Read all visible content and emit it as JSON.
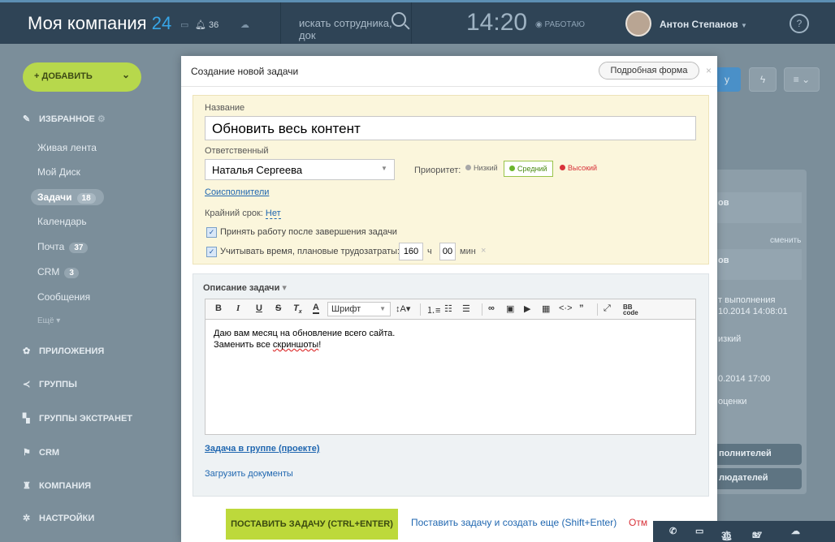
{
  "header": {
    "logo_text": "Моя компания",
    "logo_num": "24",
    "notif_count": "36",
    "search_placeholder": "искать сотрудника, док",
    "time": "14:20",
    "work_status": "РАБОТАЮ",
    "user_name": "Антон Степанов",
    "help": "?"
  },
  "sidebar": {
    "add_label": "ДОБАВИТЬ",
    "favorites": "ИЗБРАННОЕ",
    "items": [
      {
        "label": "Живая лента",
        "badge": ""
      },
      {
        "label": "Мой Диск",
        "badge": ""
      },
      {
        "label": "Задачи",
        "badge": "18"
      },
      {
        "label": "Календарь",
        "badge": ""
      },
      {
        "label": "Почта",
        "badge": "37"
      },
      {
        "label": "CRM",
        "badge": "3"
      },
      {
        "label": "Сообщения",
        "badge": ""
      }
    ],
    "more": "Ещё",
    "sections": [
      "ПРИЛОЖЕНИЯ",
      "ГРУППЫ",
      "ГРУППЫ ЭКСТРАНЕТ",
      "CRM",
      "КОМПАНИЯ",
      "НАСТРОЙКИ"
    ]
  },
  "background": {
    "frag_1": "ов",
    "change": "сменить",
    "frag_2": "ов",
    "exec_label": "т выполнения",
    "exec_date": "10.2014 14:08:01",
    "prio_frag": "изкий",
    "deadline_frag": "0.2014 17:00",
    "eval_frag": "оценки",
    "btn_1": "полнителей",
    "btn_2": "людателей"
  },
  "modal": {
    "title": "Создание новой задачи",
    "full_form": "Подробная форма",
    "name_label": "Название",
    "name_value": "Обновить весь контент",
    "responsible_label": "Ответственный",
    "responsible_value": "Наталья Сергеева",
    "priority_label": "Приоритет:",
    "priority_low": "Низкий",
    "priority_mid": "Средний",
    "priority_high": "Высокий",
    "coexec_link": "Соисполнители",
    "deadline_label": "Крайний срок:",
    "deadline_value": "Нет",
    "check_accept": "Принять работу после завершения задачи",
    "check_time": "Учитывать время, плановые трудозатраты:",
    "hours_value": "160",
    "hours_unit": "ч",
    "minutes_value": "00",
    "minutes_unit": "мин",
    "desc_label": "Описание задачи",
    "font_label": "Шрифт",
    "desc_line1": "Даю вам месяц на обновление всего сайта.",
    "desc_line2_a": "Заменить все ",
    "desc_line2_b": "скриншоты",
    "desc_line2_c": "!",
    "group_link": "Задача в группе (проекте)",
    "upload_link": "Загрузить документы",
    "submit": "ПОСТАВИТЬ ЗАДАЧУ (CTRL+ENTER)",
    "submit_more": "Поставить задачу и создать еще (Shift+Enter)",
    "cancel": "Отм"
  },
  "bottombar": {
    "notif": "36",
    "mail": "37"
  },
  "colors": {
    "accent_green": "#bdd93b",
    "topbar": "#2f4456",
    "link": "#2067b0",
    "danger": "#d8333a"
  }
}
